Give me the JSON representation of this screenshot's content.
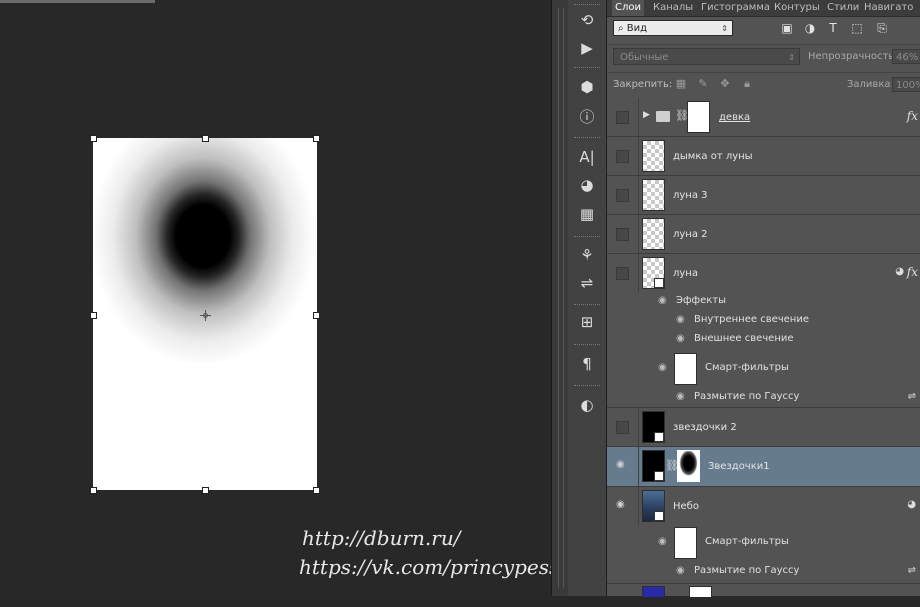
{
  "canvas": {
    "watermark_line1": "http://dburn.ru/",
    "watermark_line2": "https://vk.com/princypessa"
  },
  "toolstrip": {
    "tools": [
      "history-icon",
      "actions-play-icon",
      "3d-icon",
      "info-icon",
      "character-icon",
      "swatches-icon",
      "grid-icon",
      "brushes-icon",
      "brush-preset-icon",
      "clone-source-icon",
      "paragraph-icon",
      "adjustments-icon"
    ]
  },
  "tabs": [
    "Слои",
    "Каналы",
    "Гистограмма",
    "Контуры",
    "Стили",
    "Навигато"
  ],
  "filter": {
    "kind_value": "Вид"
  },
  "blend": {
    "mode": "Обычные",
    "opacity_label": "Непрозрачность:",
    "opacity_value": "46%"
  },
  "lock": {
    "label": "Закрепить:",
    "fill_label": "Заливка:",
    "fill_value": "100%"
  },
  "layers": [
    {
      "name": "девка",
      "type": "group",
      "visible": false,
      "fx": "fx"
    },
    {
      "name": "дымка от луны",
      "visible": false
    },
    {
      "name": "луна 3",
      "visible": false
    },
    {
      "name": "луна 2",
      "visible": false
    },
    {
      "name": "луна",
      "visible": false,
      "fx": "fx",
      "effects_label": "Эффекты",
      "effects": [
        "Внутреннее свечение",
        "Внешнее свечение"
      ],
      "smart_filters_label": "Смарт-фильтры",
      "smart_filters": [
        "Размытие по Гауссу"
      ]
    },
    {
      "name": "звездочки 2",
      "visible": false
    },
    {
      "name": "Звездочки1",
      "visible": true,
      "selected": true
    },
    {
      "name": "Небо",
      "visible": true,
      "smart_filters_label": "Смарт-фильтры",
      "smart_filters": [
        "Размытие по Гауссу"
      ]
    }
  ],
  "colors": {
    "panel_bg": "#535353",
    "selected_row": "#677b8f",
    "canvas_bg": "#282828"
  }
}
